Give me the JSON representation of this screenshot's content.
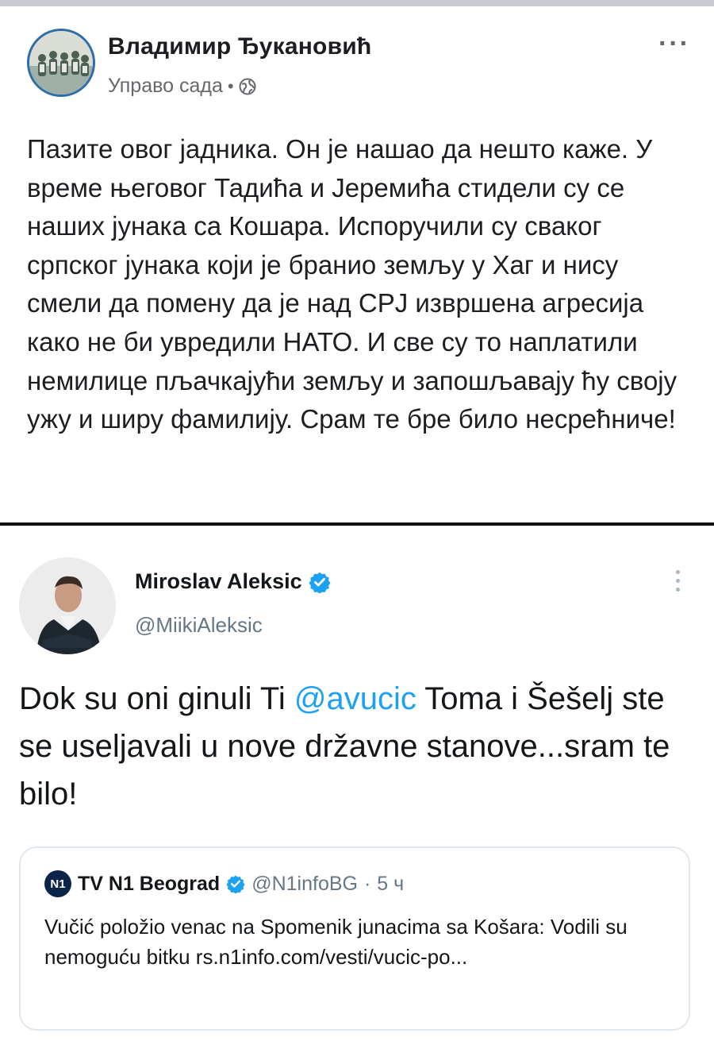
{
  "facebook_post": {
    "author": "Владимир Ђукановић",
    "time": "Управо сада",
    "separator": "•",
    "privacy_icon": "globe-icon",
    "more_label": "···",
    "text": "Пазите овог јадника. Он је нашао да нешто каже. У време његовог Тадића и Јеремића стидели су се наших јунака са Кошара. Испоручили су сваког српског јунака који је бранио земљу у Хаг и нису смели да помену да је над СРЈ извршена агресија како не би увредили НАТО. И све су то наплатили немилице пљачкајући земљу и запошљавају ћу своју ужу и ширу фамилију. Срам те бре било несрећниче!"
  },
  "tweet": {
    "author": "Miroslav Aleksic",
    "handle": "@MiikiAleksic",
    "verified_icon": "verified-badge-icon",
    "text_before": "Dok su oni ginuli Ti ",
    "mention": "@avucic",
    "text_after": " Toma i Šešelj ste se useljavali u nove državne stanove...sram te bilo!",
    "quoted": {
      "logo": "N1",
      "author": "TV N1 Beograd",
      "handle": "@N1infoBG",
      "separator": "·",
      "time": "5 ч",
      "text": "Vučić položio venac na Spomenik junacima sa Košara: Vodili su nemoguću bitku rs.n1info.com/vesti/vucic-po..."
    }
  },
  "colors": {
    "link_blue": "#1da1f2",
    "fb_text": "#1c1e21",
    "meta_gray": "#65676b"
  }
}
